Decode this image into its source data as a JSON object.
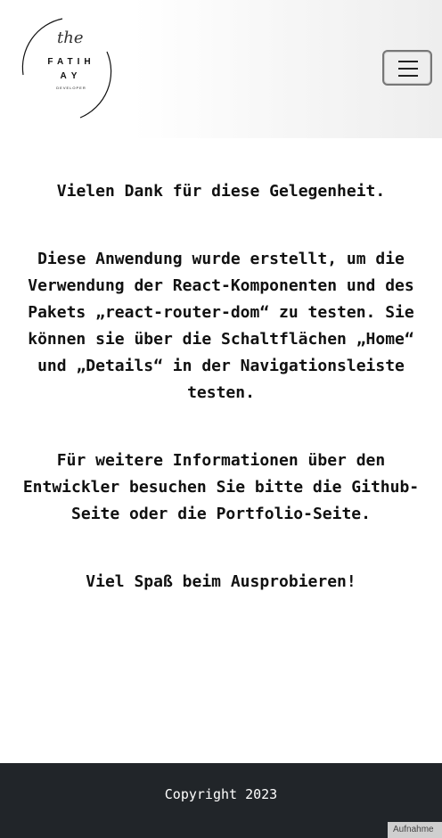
{
  "header": {
    "logo": {
      "script_text": "the",
      "line1": "FATIH",
      "line2": "AY",
      "subtitle": "DEVELOPER"
    },
    "menu_icon": "hamburger-icon"
  },
  "main": {
    "paragraphs": [
      "Vielen Dank für diese Gelegenheit.",
      "Diese Anwendung wurde erstellt, um die Verwendung der React-Komponenten und des Pakets „react-router-dom“ zu testen. Sie können sie über die Schaltflächen „Home“ und „Details“ in der Navigationsleiste testen.",
      "Für weitere Informationen über den Entwickler besuchen Sie bitte die Github-Seite oder die Portfolio-Seite.",
      "Viel Spaß beim Ausprobieren!"
    ]
  },
  "footer": {
    "copyright": "Copyright 2023"
  },
  "overlay": {
    "label": "Aufnahme"
  },
  "colors": {
    "footer_bg": "#212529",
    "text": "#111111"
  }
}
